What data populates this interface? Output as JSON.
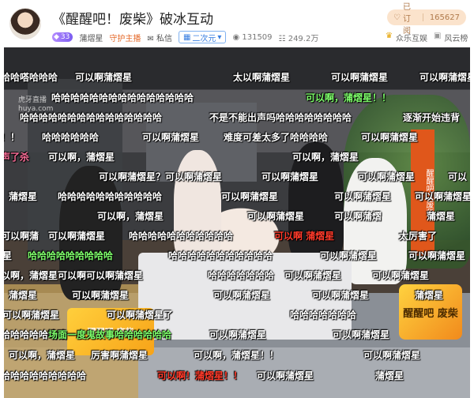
{
  "header": {
    "title": "《醒醒吧！废柴》破冰互动",
    "level": "33",
    "streamer": "蒲熠星",
    "guard_label": "守护主播",
    "message_label": "私信",
    "category": "二次元",
    "views": "131509",
    "popularity": "249.2万",
    "subscribe_label": "已订阅",
    "subscribe_count": "165627",
    "tags": [
      "众乐互娱",
      "风云榜"
    ]
  },
  "video": {
    "watermark_line1": "虎牙直播",
    "watermark_line2": "huya.com",
    "banner_text": "醒醒吧！废柴",
    "logo_text": "醒醒吧 废柴",
    "sign_text": "醒醒吧 废柴"
  },
  "danmaku": [
    {
      "text": "哈哈嗒哈哈哈",
      "color": "white"
    },
    {
      "text": "可以啊蒲熠星",
      "color": "white"
    },
    {
      "text": "太以啊蒲熠星",
      "color": "white"
    },
    {
      "text": "可以啊蒲熠星",
      "color": "white"
    },
    {
      "text": "可以啊蒲熠星",
      "color": "white"
    },
    {
      "text": "哈哈哈哈哈哈哈哈哈哈哈哈哈哈哈",
      "color": "white"
    },
    {
      "text": "可以啊，蒲熠星！！",
      "color": "green"
    },
    {
      "text": "哈哈哈哈哈哈哈哈哈哈哈哈哈哈哈",
      "color": "white"
    },
    {
      "text": "不是不能出声吗哈哈哈哈哈哈哈哈",
      "color": "white"
    },
    {
      "text": "逐渐开始违背",
      "color": "white"
    },
    {
      "text": "！！",
      "color": "white"
    },
    {
      "text": "哈哈哈哈哈哈",
      "color": "white"
    },
    {
      "text": "可以啊蒲熠星",
      "color": "white"
    },
    {
      "text": "难度可差太多了哈哈哈哈",
      "color": "white"
    },
    {
      "text": "可以啊蒲熠星",
      "color": "white"
    },
    {
      "text": "声了杀",
      "color": "pink"
    },
    {
      "text": "可以啊，蒲熠星",
      "color": "white"
    },
    {
      "text": "可以啊，蒲熠星",
      "color": "white"
    },
    {
      "text": "可以啊蒲熠星？可以啊蒲熠星",
      "color": "white"
    },
    {
      "text": "可以啊蒲熠星",
      "color": "white"
    },
    {
      "text": "可以啊蒲熠星",
      "color": "white"
    },
    {
      "text": "可以",
      "color": "white"
    },
    {
      "text": "蒲熠星",
      "color": "white"
    },
    {
      "text": "哈哈哈哈哈哈哈哈哈哈哈",
      "color": "white"
    },
    {
      "text": "可以啊蒲熠星",
      "color": "white"
    },
    {
      "text": "可以啊蒲熠星",
      "color": "white"
    },
    {
      "text": "可以啊蒲熠星",
      "color": "white"
    },
    {
      "text": "可以啊，蒲熠星",
      "color": "white"
    },
    {
      "text": "可以啊蒲熠星",
      "color": "white"
    },
    {
      "text": "可以啊蒲熠",
      "color": "white"
    },
    {
      "text": "蒲熠星",
      "color": "white"
    },
    {
      "text": "可以啊蒲熠星",
      "color": "white"
    },
    {
      "text": "哈哈哈哈哈哈哈哈哈哈哈",
      "color": "white"
    },
    {
      "text": "可以啊 蒲熠星",
      "color": "red"
    },
    {
      "text": "太厉害了",
      "color": "white"
    },
    {
      "text": "可以啊蒲",
      "color": "white"
    },
    {
      "text": "星",
      "color": "white"
    },
    {
      "text": "哈哈哈哈哈哈哈哈哈",
      "color": "green"
    },
    {
      "text": "哈哈哈哈哈哈哈哈哈哈哈",
      "color": "white"
    },
    {
      "text": "可以啊蒲熠星",
      "color": "white"
    },
    {
      "text": "可以啊蒲熠星",
      "color": "white"
    },
    {
      "text": "以啊，蒲熠星可以啊可以啊蒲熠星",
      "color": "white"
    },
    {
      "text": "哈哈哈哈哈哈哈",
      "color": "white"
    },
    {
      "text": "可以啊蒲熠星",
      "color": "white"
    },
    {
      "text": "可以啊蒲熠星",
      "color": "white"
    },
    {
      "text": "蒲熠星",
      "color": "white"
    },
    {
      "text": "可以啊蒲熠星",
      "color": "white"
    },
    {
      "text": "可以啊蒲熠星",
      "color": "white"
    },
    {
      "text": "可以啊蒲熠星",
      "color": "white"
    },
    {
      "text": "蒲熠星",
      "color": "white"
    },
    {
      "text": "可以啊蒲熠星了",
      "color": "white"
    },
    {
      "text": "哈哈哈哈哈哈哈",
      "color": "white"
    },
    {
      "text": "可以啊蒲熠星",
      "color": "white"
    },
    {
      "text": "哈哈哈哈哈哈哈",
      "color": "white"
    },
    {
      "text": "场面一度鬼故事哈哈哈哈哈哈",
      "color": "green"
    },
    {
      "text": "可以啊蒲熠星",
      "color": "white"
    },
    {
      "text": "可以啊蒲熠星",
      "color": "white"
    },
    {
      "text": "可以啊，蒲熠星",
      "color": "white"
    },
    {
      "text": "厉害啊蒲熠星",
      "color": "white"
    },
    {
      "text": "可以啊，蒲熠星！！",
      "color": "white"
    },
    {
      "text": "可以啊蒲熠星",
      "color": "white"
    },
    {
      "text": "哈哈哈哈哈哈哈哈哈",
      "color": "white"
    },
    {
      "text": "可以啊！蒲熠星！！",
      "color": "red"
    },
    {
      "text": "可以啊蒲熠星",
      "color": "white"
    },
    {
      "text": "蒲熠星",
      "color": "white"
    }
  ]
}
